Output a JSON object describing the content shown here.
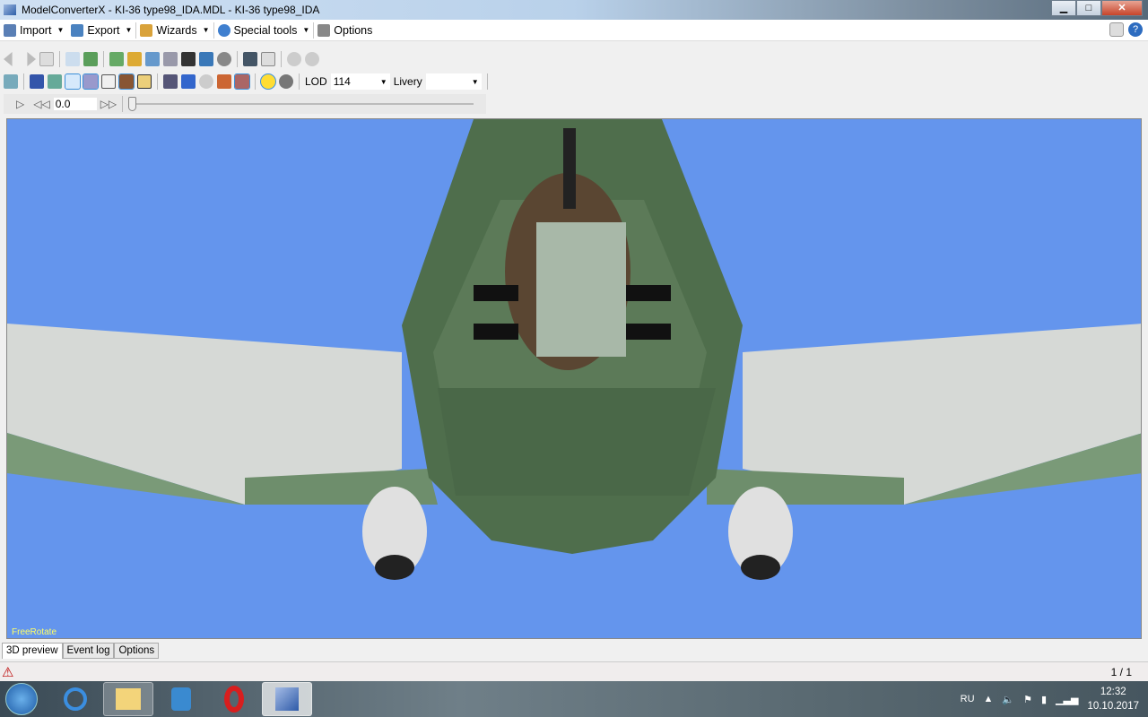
{
  "window": {
    "title": "ModelConverterX - KI-36 type98_IDA.MDL - KI-36 type98_IDA",
    "minimize": "▁",
    "maximize": "□",
    "close": "✕"
  },
  "menu": [
    {
      "label": "Import",
      "color": "#5a7fb5"
    },
    {
      "label": "Export",
      "color": "#4a82c0"
    },
    {
      "label": "Wizards",
      "color": "#d9a23a"
    },
    {
      "label": "Special tools",
      "color": "#3f7fcf"
    },
    {
      "label": "Options",
      "color": "#777"
    }
  ],
  "toolbar": {
    "lod_label": "LOD",
    "lod_value": "114",
    "livery_label": "Livery",
    "livery_value": "",
    "time_value": "0.0"
  },
  "viewport": {
    "mode": "FreeRotate",
    "sky_color": "#6495ed"
  },
  "tabs": [
    {
      "label": "3D preview",
      "active": true
    },
    {
      "label": "Event log"
    },
    {
      "label": "Options"
    }
  ],
  "status": {
    "warning": "⚠",
    "pages": "1 / 1"
  },
  "taskbar": {
    "lang": "RU",
    "time": "12:32",
    "date": "10.10.2017"
  }
}
